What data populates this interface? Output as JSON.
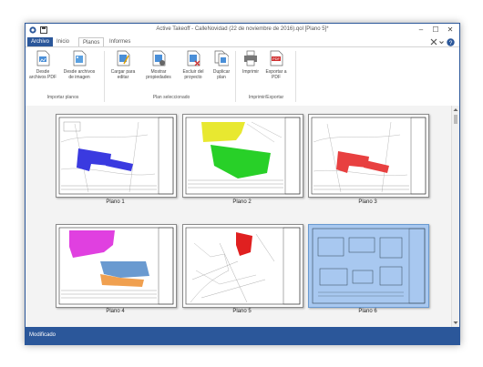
{
  "window": {
    "title": "Active Takeoff - CalleNovidad (22 de noviembre de 2016).qol [Plano 5]*"
  },
  "window_controls": {
    "minimize": "–",
    "maximize": "☐",
    "close": "✕"
  },
  "tabs": [
    {
      "label": "Archivo"
    },
    {
      "label": "Inicio"
    },
    {
      "label": "Planos"
    },
    {
      "label": "Informes"
    }
  ],
  "ribbon": {
    "groups": [
      {
        "label": "Importar planos",
        "buttons": [
          {
            "label": "Desde archivos PDF",
            "icon": "pdf-import-icon"
          },
          {
            "label": "Desde archivos de imagen",
            "icon": "image-import-icon"
          }
        ]
      },
      {
        "label": "Plan seleccionado",
        "buttons": [
          {
            "label": "Cargar para editar",
            "icon": "edit-plan-icon"
          },
          {
            "label": "Mostrar propiedades",
            "icon": "properties-icon"
          },
          {
            "label": "Excluir del proyecto",
            "icon": "exclude-icon"
          },
          {
            "label": "Duplicar plan",
            "icon": "duplicate-icon"
          }
        ]
      },
      {
        "label": "Imprimir/Exportar",
        "buttons": [
          {
            "label": "Imprimir",
            "icon": "printer-icon"
          },
          {
            "label": "Exportar a PDF",
            "icon": "export-pdf-icon"
          }
        ]
      }
    ]
  },
  "plans": [
    {
      "label": "Plano 1",
      "accent": "#3a3ae0"
    },
    {
      "label": "Plano 2",
      "accent": "#28d028"
    },
    {
      "label": "Plano 3",
      "accent": "#e84040"
    },
    {
      "label": "Plano 4",
      "accent": "#e040e0"
    },
    {
      "label": "Plano 5",
      "accent": "#e02020"
    },
    {
      "label": "Plano 6",
      "accent": "#a8c8f0"
    }
  ],
  "status": {
    "text": "Modificado"
  },
  "colors": {
    "brand": "#2b579a"
  }
}
